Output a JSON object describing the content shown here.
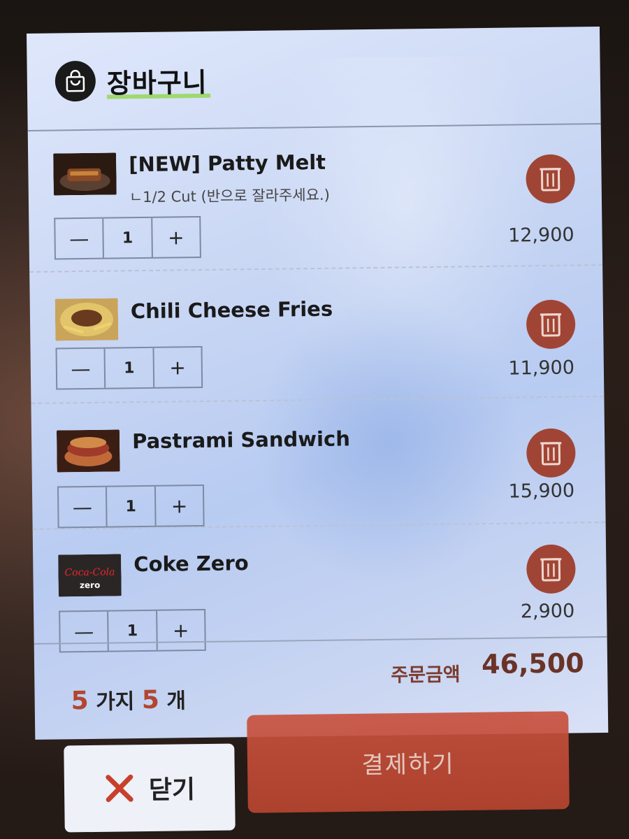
{
  "header": {
    "title": "장바구니",
    "icon": "shopping-bag-icon"
  },
  "items": [
    {
      "name": "[NEW] Patty Melt",
      "option": "ㄴ1/2 Cut (반으로 잘라주세요.)",
      "qty": "1",
      "price": "12,900",
      "minus": "—",
      "plus": "+"
    },
    {
      "name": "Chili Cheese Fries",
      "option": "",
      "qty": "1",
      "price": "11,900",
      "minus": "—",
      "plus": "+"
    },
    {
      "name": "Pastrami Sandwich",
      "option": "",
      "qty": "1",
      "price": "15,900",
      "minus": "—",
      "plus": "+"
    },
    {
      "name": "Coke Zero",
      "option": "",
      "qty": "1",
      "price": "2,900",
      "minus": "—",
      "plus": "+"
    }
  ],
  "thumb_text": {
    "coke_brand": "Coca-Cola",
    "coke_sub": "zero"
  },
  "summary": {
    "kinds_count": "5",
    "kinds_label": "가지",
    "items_count": "5",
    "items_label": "개",
    "total_label": "주문금액",
    "total_value": "46,500"
  },
  "buttons": {
    "close_label": "닫기",
    "pay_label": "결제하기"
  },
  "colors": {
    "accent_red": "#a04535",
    "pay_button": "#c24c38",
    "highlight_green": "#9fd96e",
    "screen_bg": "#c9d7f4"
  }
}
